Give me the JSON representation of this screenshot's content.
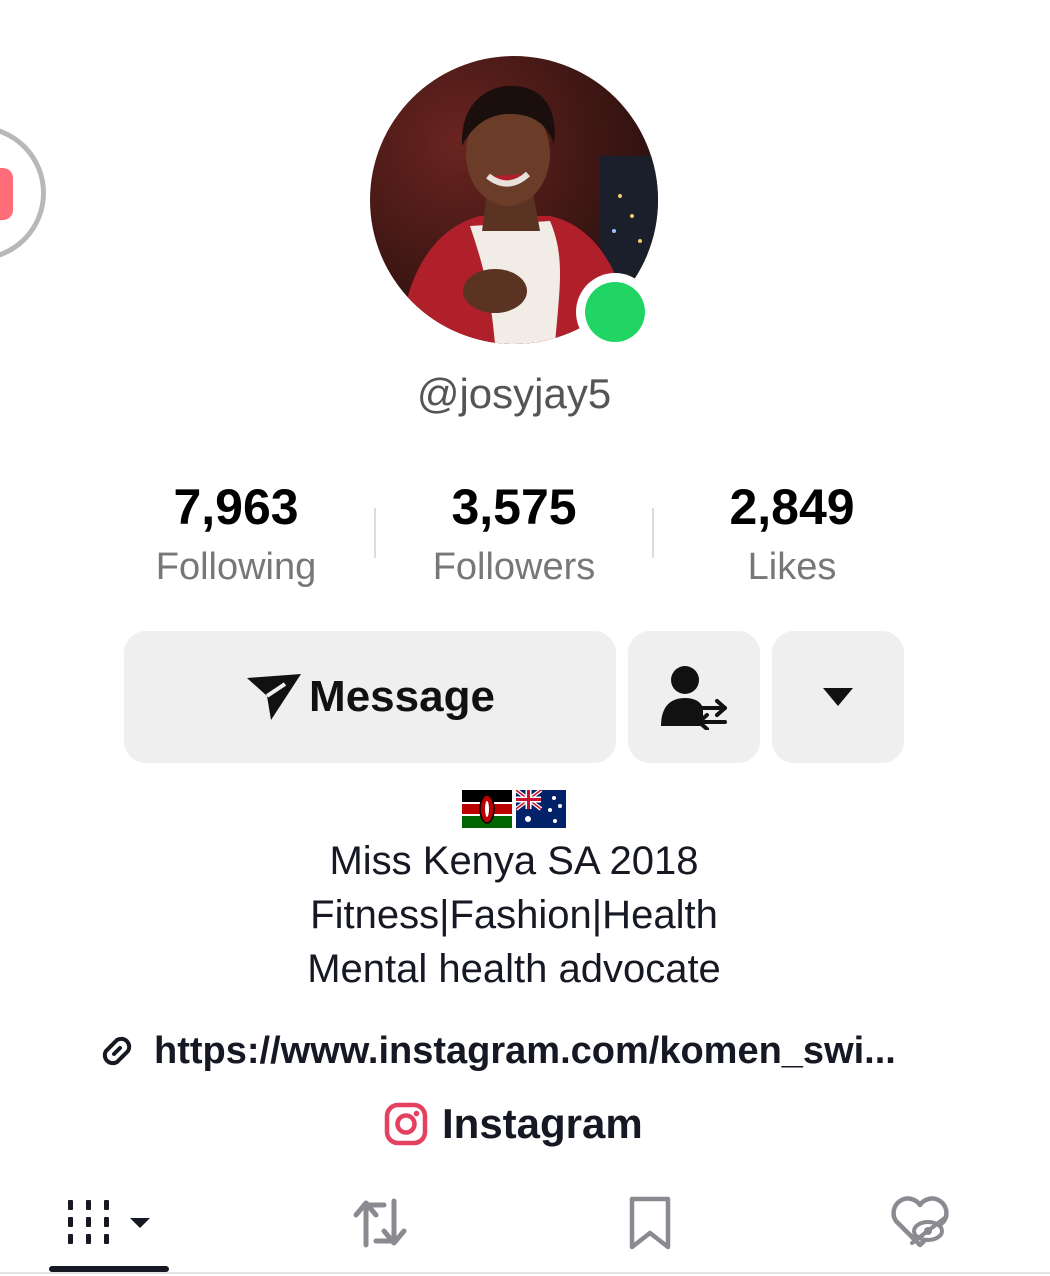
{
  "profile": {
    "username": "@josyjay5",
    "online": true
  },
  "stats": {
    "following": {
      "value": "7,963",
      "label": "Following"
    },
    "followers": {
      "value": "3,575",
      "label": "Followers"
    },
    "likes": {
      "value": "2,849",
      "label": "Likes"
    }
  },
  "actions": {
    "message_label": "Message",
    "friend_icon": "user-switch-icon",
    "more_icon": "caret-down-icon"
  },
  "bio": {
    "flags": [
      "🇰🇪",
      "🇦🇺"
    ],
    "lines": [
      "Miss Kenya SA 2018",
      "Fitness|Fashion|Health",
      "Mental health advocate"
    ]
  },
  "link": {
    "text": "https://www.instagram.com/komen_swi..."
  },
  "instagram": {
    "label": "Instagram"
  },
  "tabs": [
    {
      "name": "videos",
      "icon": "grid-icon",
      "active": true
    },
    {
      "name": "reposts",
      "icon": "repost-icon",
      "active": false
    },
    {
      "name": "favorites",
      "icon": "bookmark-icon",
      "active": false
    },
    {
      "name": "liked",
      "icon": "hidden-heart-icon",
      "active": false
    }
  ],
  "colors": {
    "online": "#20d564",
    "instagram": "#e4405f",
    "floating_button": "#fe6d78"
  }
}
